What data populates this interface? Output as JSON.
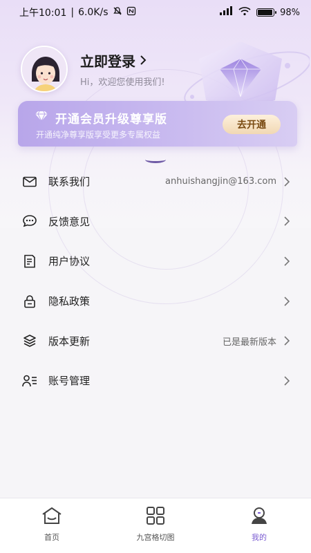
{
  "status_bar": {
    "time": "上午10:01",
    "speed": "6.0K/s",
    "battery": "98%",
    "battery_level": 0.98
  },
  "profile": {
    "login_title": "立即登录",
    "welcome": "Hi，欢迎您使用我们!"
  },
  "vip": {
    "title": "开通会员升级尊享版",
    "subtitle": "开通纯净尊享版享受更多专属权益",
    "button": "去开通"
  },
  "menu": {
    "items": [
      {
        "label": "联系我们",
        "value": "anhuishangjin@163.com",
        "icon": "mail-icon"
      },
      {
        "label": "反馈意见",
        "value": "",
        "icon": "chat-bubble-icon"
      },
      {
        "label": "用户协议",
        "value": "",
        "icon": "document-icon"
      },
      {
        "label": "隐私政策",
        "value": "",
        "icon": "lock-icon"
      },
      {
        "label": "版本更新",
        "value": "已是最新版本",
        "icon": "layers-icon"
      },
      {
        "label": "账号管理",
        "value": "",
        "icon": "user-list-icon"
      }
    ]
  },
  "bottom_nav": {
    "items": [
      {
        "label": "首页",
        "icon": "home-icon"
      },
      {
        "label": "九宫格切图",
        "icon": "grid-icon"
      },
      {
        "label": "我的",
        "icon": "profile-icon"
      }
    ]
  },
  "colors": {
    "accent": "#7a5bd1",
    "banner_start": "#b8a6ea",
    "banner_button": "#f1d8b4"
  }
}
